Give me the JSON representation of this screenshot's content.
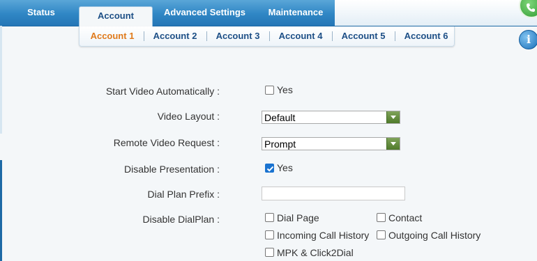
{
  "nav": {
    "tabs": [
      {
        "label": "Status"
      },
      {
        "label": "Account"
      },
      {
        "label": "Advanced Settings"
      },
      {
        "label": "Maintenance"
      }
    ],
    "active_tab": "Account"
  },
  "subnav": {
    "items": [
      {
        "label": "Account 1"
      },
      {
        "label": "Account 2"
      },
      {
        "label": "Account 3"
      },
      {
        "label": "Account 4"
      },
      {
        "label": "Account 5"
      },
      {
        "label": "Account 6"
      }
    ],
    "active": "Account 1"
  },
  "icons": {
    "phone": "phone-icon",
    "info": "info-icon"
  },
  "colors": {
    "accent": "#e07a1b",
    "brand": "#2f86c4",
    "link": "#1d4f86"
  },
  "form": {
    "start_video": {
      "label": "Start Video Automatically :",
      "option": "Yes",
      "checked": false
    },
    "video_layout": {
      "label": "Video Layout :",
      "value": "Default"
    },
    "remote_video": {
      "label": "Remote Video Request :",
      "value": "Prompt"
    },
    "disable_presentation": {
      "label": "Disable Presentation :",
      "option": "Yes",
      "checked": true
    },
    "dial_plan_prefix": {
      "label": "Dial Plan Prefix :",
      "value": ""
    },
    "disable_dialplan": {
      "label": "Disable DialPlan :",
      "options": [
        {
          "label": "Dial Page",
          "checked": false
        },
        {
          "label": "Contact",
          "checked": false
        },
        {
          "label": "Incoming Call History",
          "checked": false
        },
        {
          "label": "Outgoing Call History",
          "checked": false
        },
        {
          "label": "MPK & Click2Dial",
          "checked": false
        }
      ]
    }
  }
}
